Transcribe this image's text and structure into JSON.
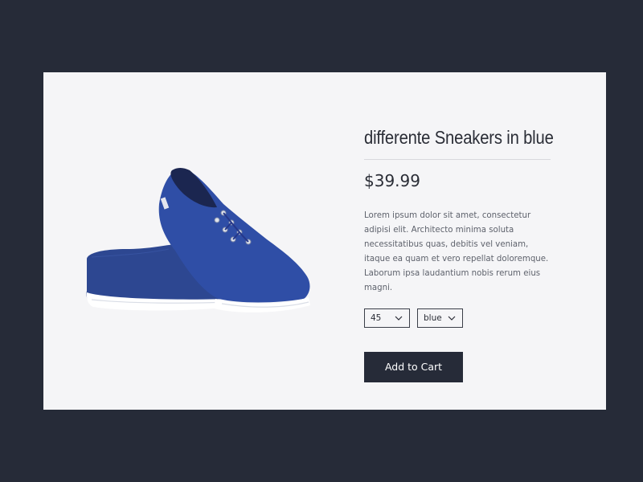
{
  "product": {
    "title": "differente Sneakers in blue",
    "price": "$39.99",
    "description": "Lorem ipsum dolor sit amet, consectetur adipisi elit. Architecto minima soluta necessitatibus quas, debitis vel veniam, itaque ea quam et vero repellat doloremque. Laborum ipsa laudantium nobis rerum eius magni.",
    "image_icon": "blue-sneakers-image"
  },
  "options": {
    "size": "45",
    "color": "blue"
  },
  "actions": {
    "add_to_cart": "Add to Cart"
  },
  "colors": {
    "background": "#262b38",
    "card": "#f5f5f7",
    "button": "#262b38",
    "shoe": "#2e4a9e"
  }
}
